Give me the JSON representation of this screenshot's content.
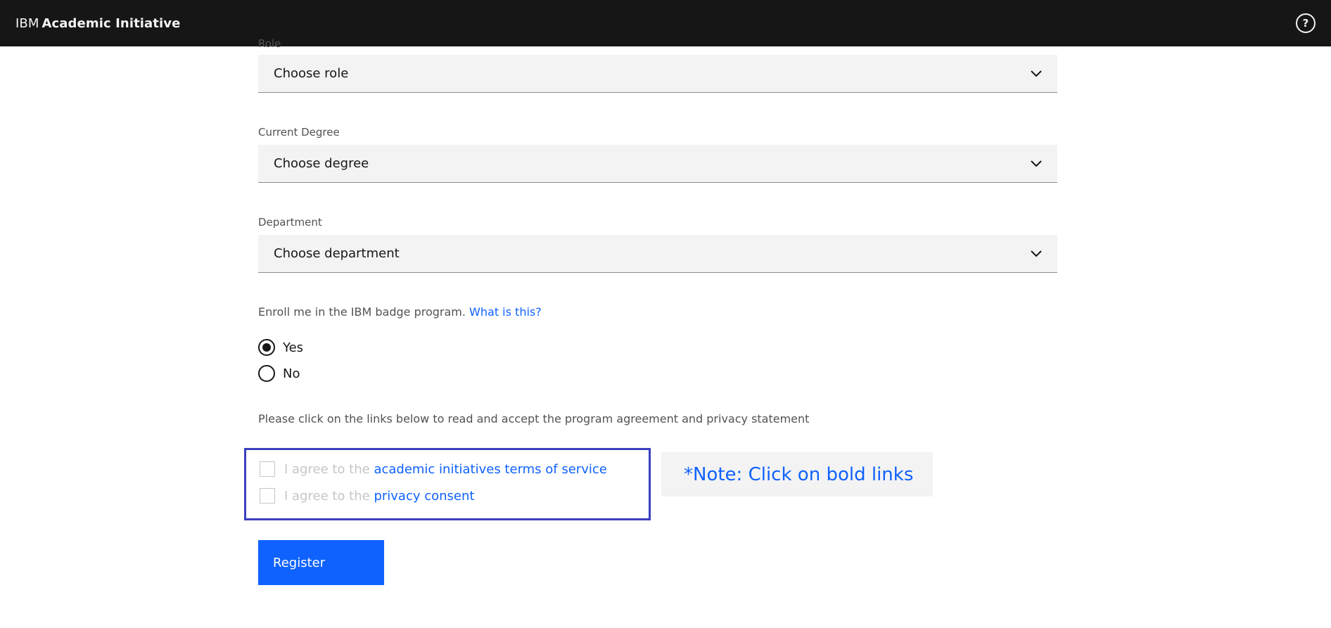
{
  "header": {
    "brand_prefix": "IBM",
    "brand_name": "Academic Initiative",
    "help_icon": "?"
  },
  "form": {
    "role": {
      "label": "Role",
      "value": "Choose role"
    },
    "degree": {
      "label": "Current Degree",
      "value": "Choose degree"
    },
    "department": {
      "label": "Department",
      "value": "Choose department"
    },
    "badge": {
      "text": "Enroll me in the IBM badge program.",
      "link": "What is this?",
      "options": [
        {
          "label": "Yes",
          "selected": true
        },
        {
          "label": "No",
          "selected": false
        }
      ]
    },
    "agreement_intro": "Please click on the links below to read and accept the program agreement and privacy statement",
    "agreements": [
      {
        "prefix": "I agree to the",
        "link": "academic initiatives terms of service",
        "checked": false
      },
      {
        "prefix": "I agree to the",
        "link": "privacy consent",
        "checked": false
      }
    ],
    "note": "*Note: Click on bold links",
    "register_label": "Register"
  },
  "colors": {
    "topbar": "#161616",
    "link": "#0f62fe",
    "primary_button": "#0f62fe",
    "highlight_box_border": "#3b3fbf",
    "field_bg": "#f3f3f3"
  }
}
